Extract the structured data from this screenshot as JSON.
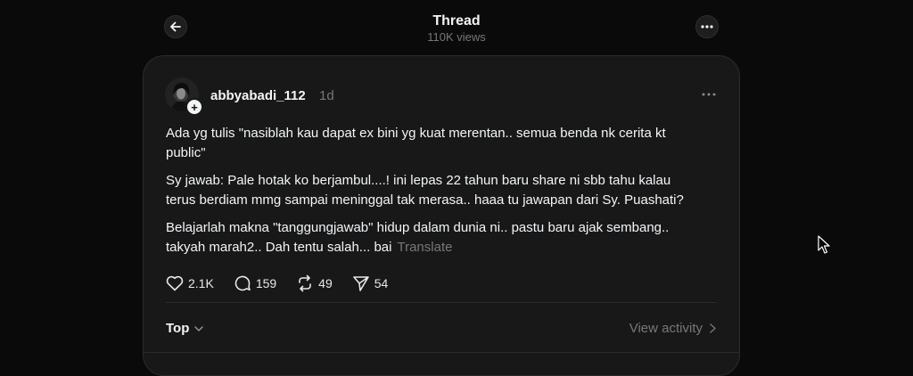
{
  "header": {
    "title": "Thread",
    "views": "110K views",
    "back_icon": "arrow-left-icon",
    "more_icon": "more-horizontal-icon"
  },
  "post": {
    "username": "abbyabadi_112",
    "time": "1d",
    "paragraphs": [
      "Ada yg tulis \"nasiblah kau dapat ex bini yg kuat merentan.. semua benda nk cerita kt public\"",
      "Sy jawab: Pale hotak ko berjambul....! ini lepas 22 tahun baru share ni sbb tahu kalau terus berdiam mmg sampai meninggal tak merasa.. haaa tu jawapan dari Sy. Puashati?",
      "Belajarlah makna \"tanggungjawab\" hidup dalam dunia ni.. pastu baru ajak sembang.. takyah marah2.. Dah tentu salah... bai"
    ],
    "translate_label": "Translate",
    "actions": {
      "likes": "2.1K",
      "replies": "159",
      "reposts": "49",
      "shares": "54"
    }
  },
  "replies_bar": {
    "sort_label": "Top",
    "view_activity_label": "View activity"
  },
  "colors": {
    "background": "#0a0a0a",
    "card": "#181818",
    "text": "#f3f5f7",
    "muted": "#777777"
  }
}
